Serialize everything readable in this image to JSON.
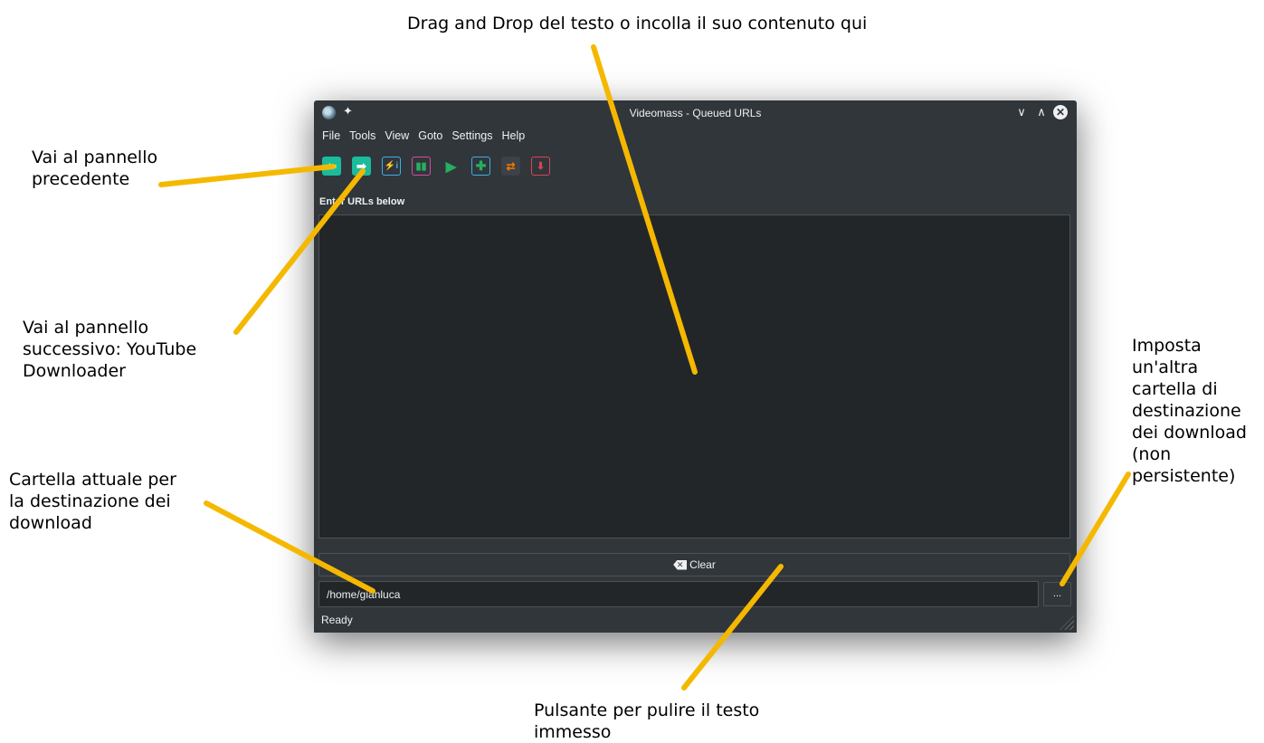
{
  "annotations": {
    "top": "Drag and Drop del testo o incolla il suo contenuto qui",
    "prev_panel": "Vai al pannello\nprecedente",
    "next_panel": "Vai al pannello\nsuccessivo: YouTube\nDownloader",
    "current_folder": "Cartella attuale per\nla destinazione dei\ndownload",
    "set_folder": "Imposta\nun'altra\ncartella di\ndestinazione\ndei download\n(non\npersistente)",
    "clear_button": "Pulsante per pulire il testo\nimmesso"
  },
  "window": {
    "title": "Videomass - Queued URLs",
    "pin_icon": "pin-icon",
    "controls": {
      "minimize": "∨",
      "maximize": "∧",
      "close": "✕"
    }
  },
  "menu": [
    "File",
    "Tools",
    "View",
    "Goto",
    "Settings",
    "Help"
  ],
  "toolbar": [
    {
      "name": "back-icon",
      "glyph": "⬅"
    },
    {
      "name": "forward-icon",
      "glyph": "➡"
    },
    {
      "name": "media-info-icon",
      "glyph": "⚡i"
    },
    {
      "name": "statistics-icon",
      "glyph": "▮▮"
    },
    {
      "name": "start-icon",
      "glyph": "▶"
    },
    {
      "name": "add-queue-icon",
      "glyph": "✚"
    },
    {
      "name": "swap-icon",
      "glyph": "⇄"
    },
    {
      "name": "stop-icon",
      "glyph": "⬇"
    }
  ],
  "main": {
    "urls_label": "Enter URLs below",
    "urls_value": "",
    "clear_label": "Clear",
    "download_path": "/home/gianluca",
    "browse_label": "...",
    "status": "Ready"
  },
  "colors": {
    "callout": "#f5b800",
    "window_bg": "#31363b",
    "field_bg": "#232629",
    "accent": "#1abc9c"
  }
}
